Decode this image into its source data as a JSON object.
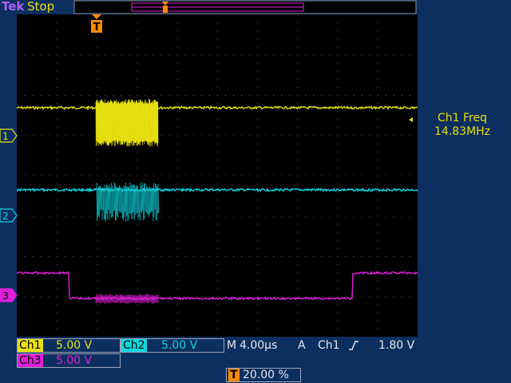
{
  "header": {
    "brand": "Tek",
    "run_state": "Stop"
  },
  "trigger_marker": {
    "label": "T"
  },
  "channel_markers": [
    {
      "label": "1",
      "color": "#e6e010"
    },
    {
      "label": "2",
      "color": "#10d6e0"
    },
    {
      "label": "3",
      "color": "#e020d8"
    }
  ],
  "measurement": {
    "title": "Ch1 Freq",
    "value": "14.83MHz"
  },
  "status": {
    "ch1_label": "Ch1",
    "ch1_scale": "5.00 V",
    "ch2_label": "Ch2",
    "ch2_scale": "5.00 V",
    "timebase_prefix": "M",
    "timebase": "4.00µs",
    "acq_mode": "A",
    "trigger_source": "Ch1",
    "trigger_slope_icon": "rising-edge-icon",
    "trigger_level": "1.80 V",
    "ch3_label": "Ch3",
    "ch3_scale": "5.00 V",
    "trigger_position_icon": "T",
    "trigger_position": "20.00 %"
  },
  "colors": {
    "ch1": "#e6e010",
    "ch2": "#10d6e0",
    "ch3": "#e020d8",
    "background": "#0d2f60",
    "graticule": "#000000",
    "trigger": "#ff8a00"
  }
}
